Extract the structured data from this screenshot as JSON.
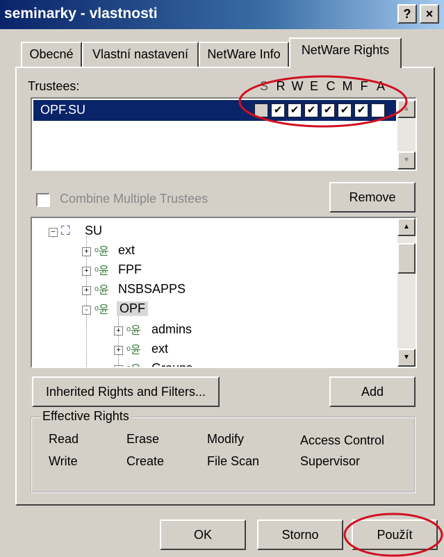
{
  "window": {
    "title": "seminarky - vlastnosti",
    "help_label": "?",
    "close_label": "×"
  },
  "tabs": [
    {
      "label": "Obecné",
      "active": false
    },
    {
      "label": "Vlastní nastavení",
      "active": false
    },
    {
      "label": "NetWare Info",
      "active": false
    },
    {
      "label": "NetWare Rights",
      "active": true
    }
  ],
  "trustees": {
    "label": "Trustees:",
    "rights_headers": [
      "S",
      "R",
      "W",
      "E",
      "C",
      "M",
      "F",
      "A"
    ],
    "items": [
      {
        "name": "OPF.SU",
        "selected": true,
        "rights": [
          false,
          true,
          true,
          true,
          true,
          true,
          true,
          false
        ]
      }
    ]
  },
  "combine_label": "Combine Multiple Trustees",
  "remove_label": "Remove",
  "tree": {
    "root": "SU",
    "nodes": [
      {
        "label": "ext",
        "level": 1,
        "expander": "+"
      },
      {
        "label": "FPF",
        "level": 1,
        "expander": "+"
      },
      {
        "label": "NSBSAPPS",
        "level": 1,
        "expander": "+"
      },
      {
        "label": "OPF",
        "level": 1,
        "expander": "-"
      },
      {
        "label": "admins",
        "level": 2,
        "expander": "+"
      },
      {
        "label": "ext",
        "level": 2,
        "expander": "+"
      },
      {
        "label": "Groups",
        "level": 2,
        "expander": "+"
      }
    ]
  },
  "inherited_label": "Inherited Rights and Filters...",
  "add_label": "Add",
  "effective_rights": {
    "title": "Effective Rights",
    "row1": [
      "Read",
      "Erase",
      "Modify",
      "Access Control"
    ],
    "row2": [
      "Write",
      "Create",
      "File Scan",
      "Supervisor"
    ]
  },
  "buttons": {
    "ok": "OK",
    "cancel": "Storno",
    "apply": "Použít"
  },
  "colors": {
    "title_bar": "#0a246a",
    "selection": "#0a246a",
    "annotation": "#d01020"
  }
}
